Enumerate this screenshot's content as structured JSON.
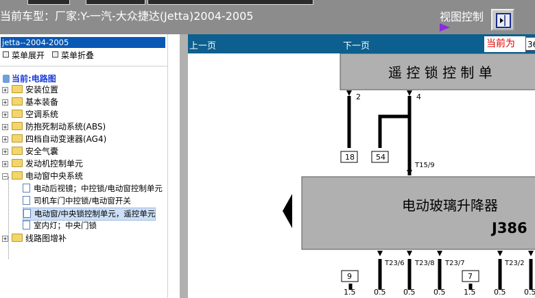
{
  "header": {
    "title": "当前车型：厂家:Y-一汽-大众捷达(Jetta)2004-2005",
    "view_control_label": "视图控制"
  },
  "sidebar": {
    "root_label": "jetta--2004-2005",
    "expand_label": "菜单展开",
    "collapse_label": "菜单折叠",
    "current_label": "当前:电路图",
    "nodes": [
      {
        "label": "安装位置",
        "toggle": "+"
      },
      {
        "label": "基本装备",
        "toggle": "+"
      },
      {
        "label": "空调系统",
        "toggle": "+"
      },
      {
        "label": "防抱死制动系统(ABS)",
        "toggle": "+"
      },
      {
        "label": "四档自动变速器(AG4)",
        "toggle": "+"
      },
      {
        "label": "安全气囊",
        "toggle": "+"
      },
      {
        "label": "发动机控制单元",
        "toggle": "+"
      },
      {
        "label": "电动窗中央系统",
        "toggle": "−"
      }
    ],
    "children": [
      {
        "label": "电动后视镜；中控锁/电动窗控制单元"
      },
      {
        "label": "司机车门中控锁/电动窗开关"
      },
      {
        "label": "电动窗/中央锁控制单元，遥控单元",
        "selected": true
      },
      {
        "label": "室内灯；中央门锁"
      }
    ],
    "last_node": {
      "label": "线路图增补",
      "toggle": "+"
    }
  },
  "nav": {
    "prev_label": "上一页",
    "next_label": "下一页",
    "current_label": "当前为",
    "page_value": "36"
  },
  "diagram": {
    "remote_unit_label": "遥 控 锁 控 制 单",
    "window_unit_label": "电动玻璃升降器",
    "window_unit_code": "J386",
    "top_pins": [
      "2",
      "4"
    ],
    "top_boxes": [
      "18",
      "54"
    ],
    "connector_label": "T15/9",
    "bottom_pin_labels": [
      "T23/6",
      "T23/8",
      "T23/7",
      "T23/2"
    ],
    "bottom_boxes": [
      "9",
      "7"
    ],
    "wire_sizes": [
      "1.5",
      "0.5",
      "0.5",
      "0.5",
      "1.5",
      "0.5",
      "0.5"
    ]
  }
}
